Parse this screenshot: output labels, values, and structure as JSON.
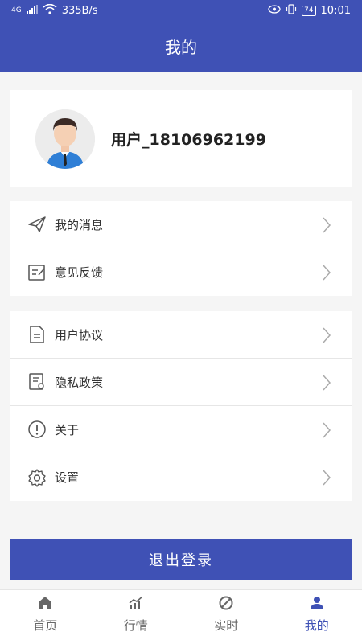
{
  "status_bar": {
    "network": "4G",
    "speed": "335B/s",
    "battery": "74",
    "time": "10:01"
  },
  "header": {
    "title": "我的"
  },
  "profile": {
    "username": "用户_18106962199"
  },
  "menu_group_1": [
    {
      "label": "我的消息",
      "icon": "paper-plane-icon"
    },
    {
      "label": "意见反馈",
      "icon": "edit-icon"
    }
  ],
  "menu_group_2": [
    {
      "label": "用户协议",
      "icon": "document-icon"
    },
    {
      "label": "隐私政策",
      "icon": "policy-icon"
    },
    {
      "label": "关于",
      "icon": "info-icon"
    },
    {
      "label": "设置",
      "icon": "gear-icon"
    }
  ],
  "logout_label": "退出登录",
  "tabbar": {
    "items": [
      {
        "label": "首页",
        "icon": "home-icon"
      },
      {
        "label": "行情",
        "icon": "chart-icon"
      },
      {
        "label": "实时",
        "icon": "realtime-icon"
      },
      {
        "label": "我的",
        "icon": "person-icon"
      }
    ],
    "active_index": 3
  },
  "colors": {
    "accent": "#3f51b5",
    "background": "#f5f5f5"
  }
}
